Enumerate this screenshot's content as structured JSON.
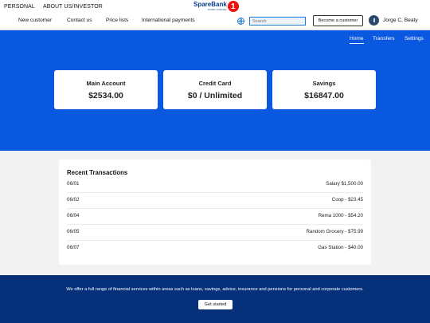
{
  "topbar": {
    "links": [
      "PERSONAL",
      "ABOUT US/INVESTOR"
    ]
  },
  "logo": {
    "brand": "SpareBank",
    "sub": "NORD-NORGE",
    "badge": "1"
  },
  "nav": {
    "items": [
      "New customer",
      "Contact us",
      "Price lists",
      "International payments"
    ],
    "search_placeholder": "Search",
    "become_customer": "Become a customer",
    "user_name": "Jorge C. Beaty"
  },
  "hero": {
    "subnav": [
      "Home",
      "Transfers",
      "Settings"
    ],
    "active_tab": "Home",
    "accounts": [
      {
        "title": "Main Account",
        "value": "$2534.00"
      },
      {
        "title": "Credit Card",
        "value": "$0 / Unlimited"
      },
      {
        "title": "Savings",
        "value": "$16847.00"
      }
    ]
  },
  "transactions": {
    "title": "Recent Transactions",
    "rows": [
      {
        "date": "06/01",
        "desc": "Salary $1,500.00"
      },
      {
        "date": "06/02",
        "desc": "Coop - $23.45"
      },
      {
        "date": "06/04",
        "desc": "Rema 1000 - $54.20"
      },
      {
        "date": "06/05",
        "desc": "Random Grocery - $75.99"
      },
      {
        "date": "06/07",
        "desc": "Gas Station - $40.00"
      }
    ]
  },
  "footer": {
    "message": "We offer a full range of financial services within areas such as loans, savings, advice, insurance and pensions for personal and corporate customers.",
    "button": "Get started"
  },
  "colors": {
    "hero_blue": "#0a58e0",
    "footer_navy": "#06307a",
    "logo_red": "#e11111"
  }
}
